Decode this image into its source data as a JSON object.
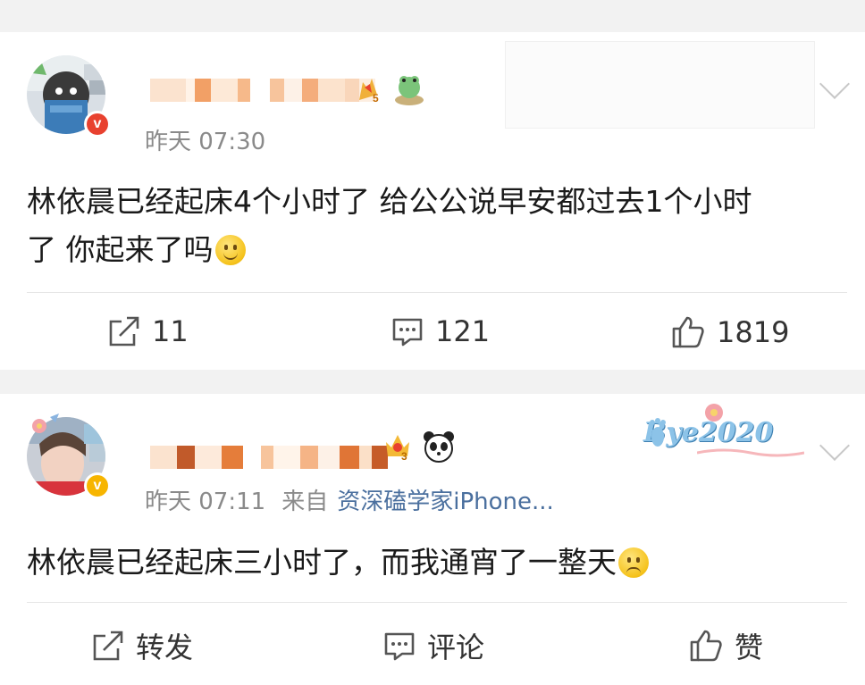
{
  "colors": {
    "background": "#f2f2f2",
    "card": "#ffffff",
    "meta_text": "#8a8a8a",
    "source_link": "#4a6f9e",
    "verified_gold": "#f7b500",
    "verified_red": "#e8412f"
  },
  "posts": [
    {
      "timestamp": "昨天 07:30",
      "verified_icon": "verified-red-v-icon",
      "level_badge": "5",
      "content": "林依晨已经起床4个小时了 给公公说早安都过去1个小时了 你起来了吗",
      "content_line1": "林依晨已经起床4个小时了 给公公说早安都过去1个小时",
      "content_line2": "了 你起来了吗",
      "emoji": "smile-emoji",
      "actions": {
        "repost": "11",
        "comment": "121",
        "like": "1819"
      }
    },
    {
      "timestamp": "昨天 07:11",
      "from_label": "来自",
      "source": "资深磕学家iPhone...",
      "verified_icon": "verified-gold-v-icon",
      "level_badge": "3",
      "card_decoration": "Bye2020",
      "content": "林依晨已经起床三小时了，而我通宵了一整天",
      "emoji": "sad-emoji",
      "actions": {
        "repost": "转发",
        "comment": "评论",
        "like": "赞"
      }
    }
  ]
}
